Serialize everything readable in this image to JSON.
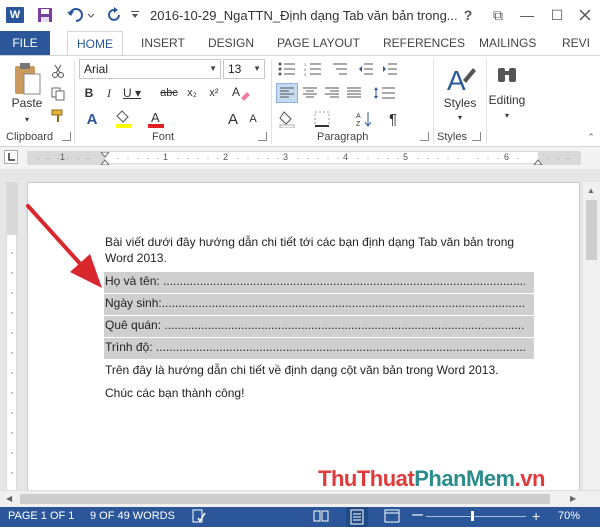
{
  "window": {
    "title": "2016-10-29_NgaTTN_Định dạng Tab văn bản trong...",
    "app_icon": "W",
    "help": "?",
    "restore": "⧉",
    "minimize": "—",
    "maximize": "☐"
  },
  "tabs": [
    "FILE",
    "HOME",
    "INSERT",
    "DESIGN",
    "PAGE LAYOUT",
    "REFERENCES",
    "MAILINGS",
    "REVI"
  ],
  "ribbon": {
    "clipboard": {
      "label": "Clipboard",
      "paste": "Paste"
    },
    "font": {
      "label": "Font",
      "name": "Arial",
      "size": "13"
    },
    "paragraph": {
      "label": "Paragraph"
    },
    "styles": {
      "label": "Styles",
      "button": "Styles"
    },
    "editing": {
      "button": "Editing"
    }
  },
  "ruler": {
    "numbers": [
      "1",
      "1",
      "2",
      "3",
      "4",
      "5",
      "6"
    ]
  },
  "document": {
    "intro_line1": "Bài viết dưới đây hướng dẫn chi tiết tới các bạn định dạng Tab văn bản trong",
    "intro_line2": "Word 2013.",
    "fields": [
      "Họ và tên: ....................................................................................................................",
      "Ngày sinh:.....................................................................................................................",
      "Quê quán: ....................................................................................................................",
      "Trình độ: ......................................................................................................................"
    ],
    "summary": "Trên đây là hướng dẫn chi tiết về định dạng cột văn bản trong Word 2013.",
    "closing": "Chúc các bạn thành công!"
  },
  "status": {
    "page": "PAGE 1 OF 1",
    "words": "9 OF 49 WORDS",
    "zoom": "70%",
    "zoom_fraction": 0.45
  },
  "watermark": {
    "part1": "ThuThuat",
    "part2": "PhanMem",
    "part3": ".vn"
  },
  "colors": {
    "accent": "#2b579a",
    "arrow": "#d9272e",
    "watermark_red": "#e03a3a",
    "watermark_teal": "#2a8c8c"
  }
}
